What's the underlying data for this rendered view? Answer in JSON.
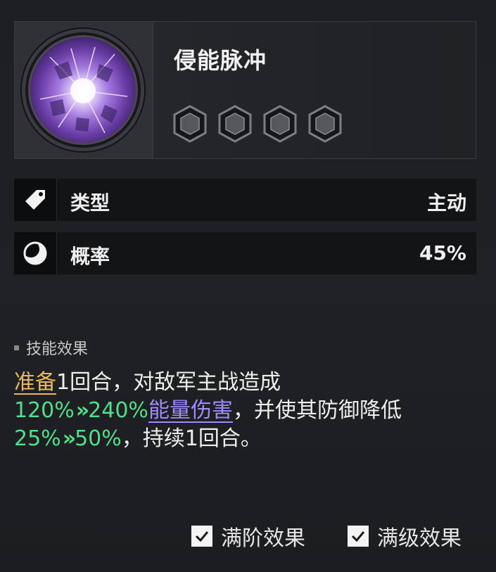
{
  "skill": {
    "name": "侵能脉冲",
    "icon": "purple-energy-orb-icon",
    "level_slots": 4,
    "level_filled": 0
  },
  "stats": [
    {
      "label": "类型",
      "value": "主动",
      "icon": "tag-icon"
    },
    {
      "label": "概率",
      "value": "45%",
      "icon": "crescent-moon-icon"
    }
  ],
  "description": {
    "section_title": "技能效果",
    "line1": {
      "keyword": "准备",
      "text": "1回合，对敌军主战造成"
    },
    "line2": {
      "from": "120%",
      "to": "240%",
      "damage_type": "能量伤害",
      "text": "，并使其防御降低"
    },
    "line3": {
      "from": "25%",
      "to": "50%",
      "text": "，持续1回合。"
    },
    "arrow": "»"
  },
  "toggles": {
    "max_rank": {
      "label": "满阶效果",
      "checked": true
    },
    "max_level": {
      "label": "满级效果",
      "checked": true
    }
  },
  "colors": {
    "keyword_gold": "#e9b95c",
    "value_green": "#4ee08a",
    "damage_purple": "#a08cff"
  }
}
